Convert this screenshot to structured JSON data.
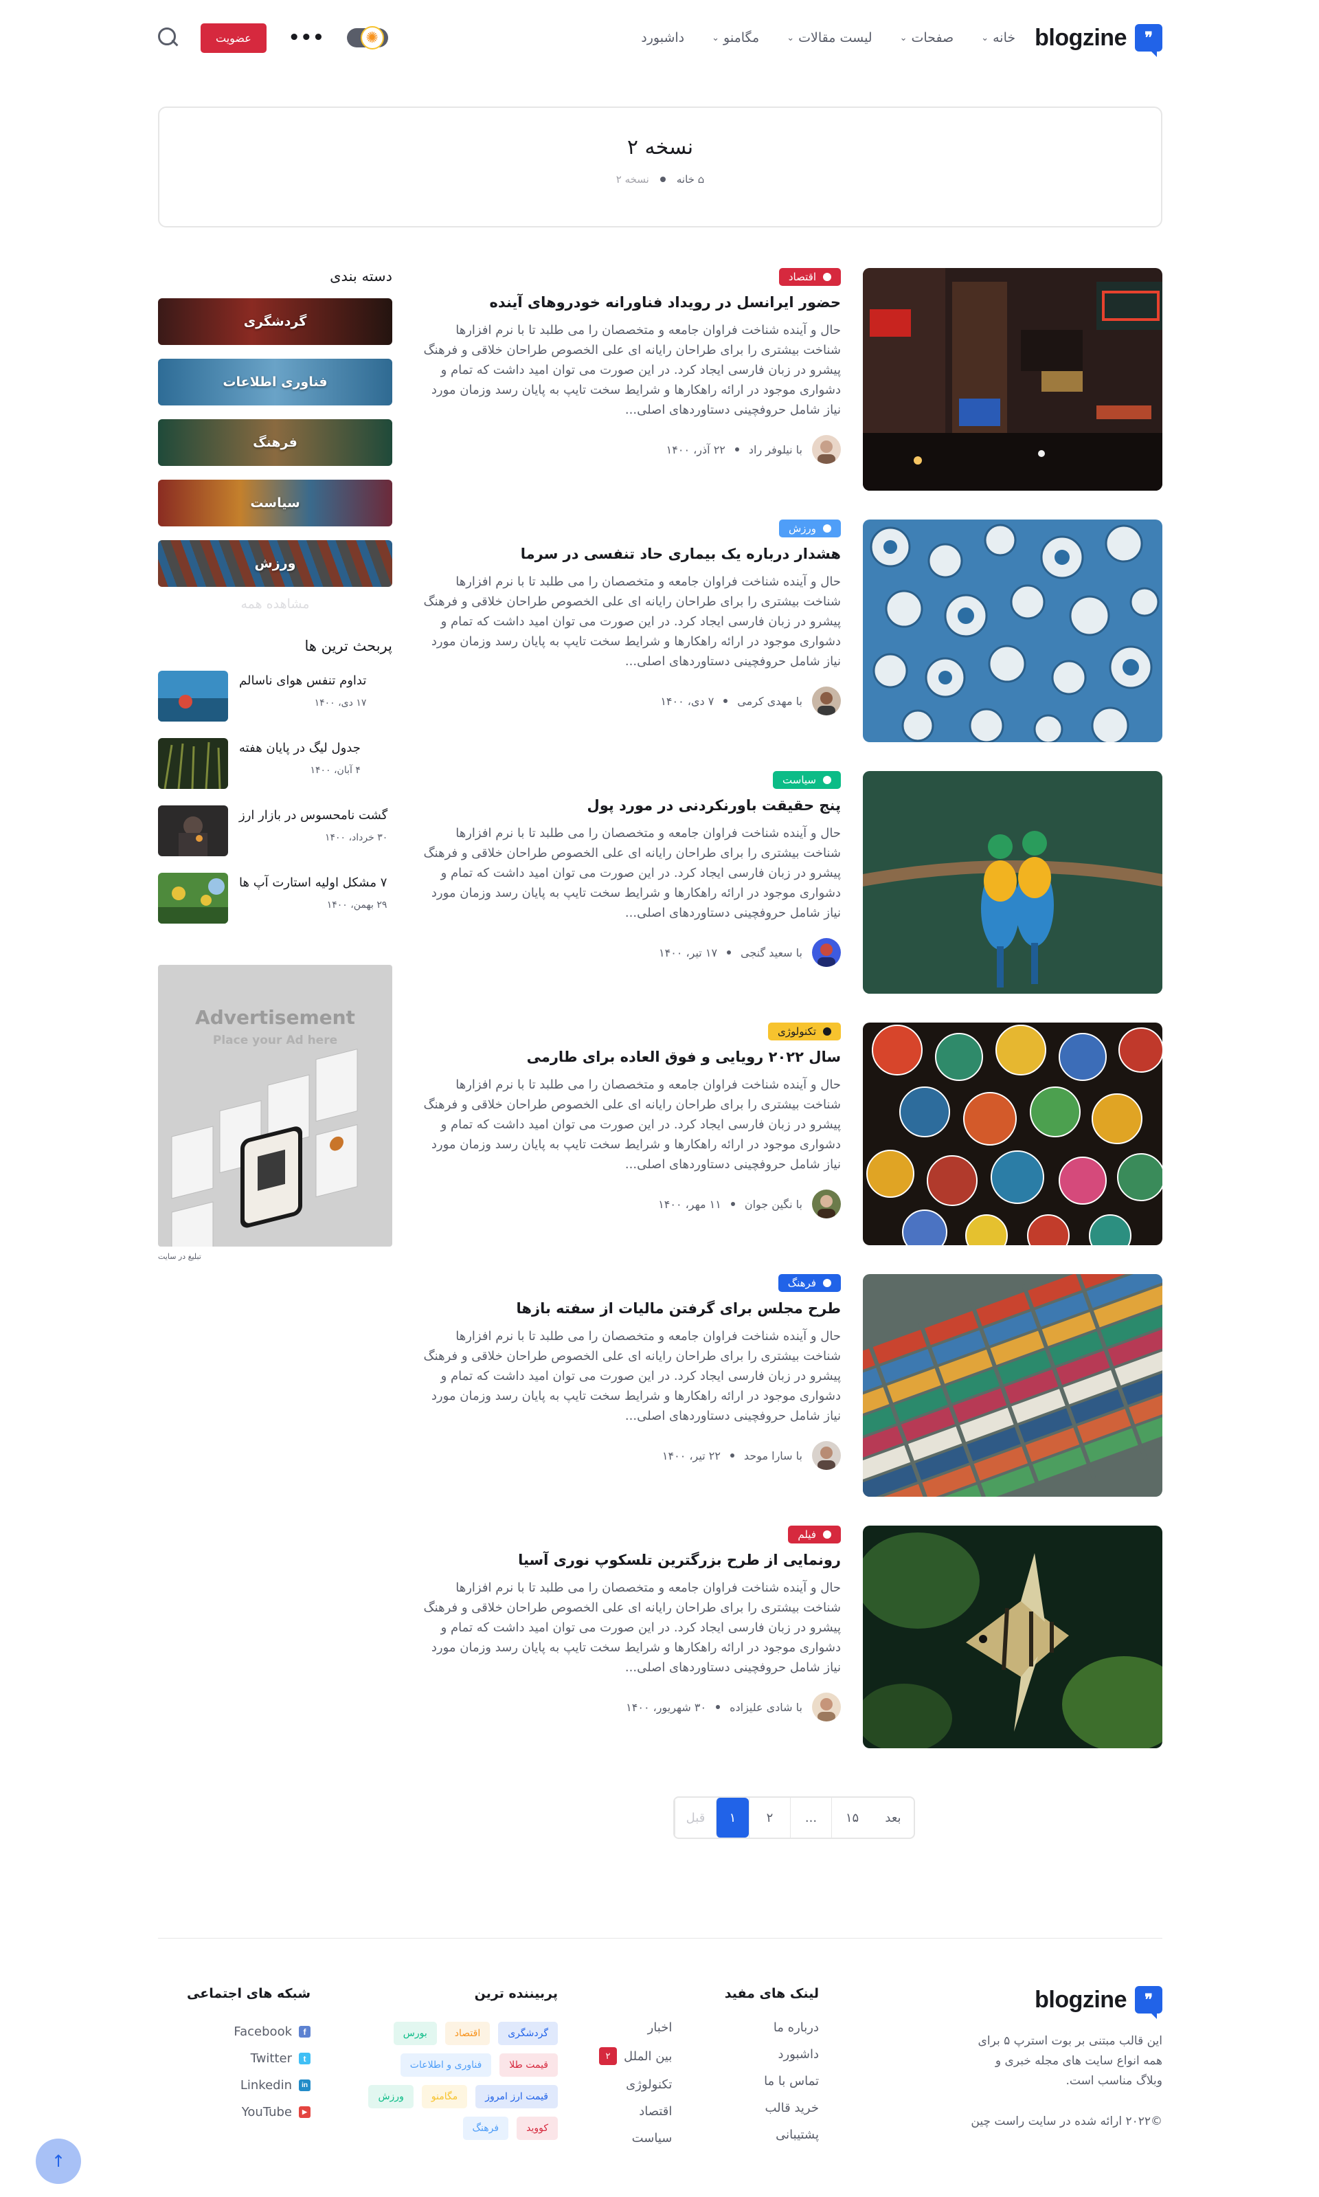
{
  "header": {
    "logo_text": "blogzine",
    "nav": [
      {
        "label": "خانه",
        "has_dropdown": true
      },
      {
        "label": "صفحات",
        "has_dropdown": true
      },
      {
        "label": "لیست مقالات",
        "has_dropdown": true
      },
      {
        "label": "مگامنو",
        "has_dropdown": true
      },
      {
        "label": "داشبورد",
        "has_dropdown": false
      }
    ],
    "join_label": "عضویت",
    "more_label": "•••"
  },
  "page_title": "نسخه ۲",
  "breadcrumb": {
    "home": "خانه",
    "current": "نسخه ۲"
  },
  "posts": [
    {
      "badge": "اقتصاد",
      "badge_color": "#d6293e",
      "title": "حضور ایرانسل در رویداد فناورانه خودروهای آینده",
      "excerpt": "حال و آینده شناخت فراوان جامعه و متخصصان را می طلبد تا با نرم افزارها شناخت بیشتری را برای طراحان رایانه ای علی الخصوص طراحان خلاقی و فرهنگ پیشرو در زبان فارسی ایجاد کرد. در این صورت می توان امید داشت که تمام و دشواری موجود در ارائه راهکارها و شرایط سخت تایپ به پایان رسد وزمان مورد نیاز شامل حروفچینی دستاوردهای اصلی...",
      "author": "با نیلوفر راد",
      "date": "۲۲ آذر، ۱۴۰۰"
    },
    {
      "badge": "ورزش",
      "badge_color": "#4f9ef8",
      "title": "هشدار درباره یک بیماری حاد تنفسی در سرما",
      "excerpt": "حال و آینده شناخت فراوان جامعه و متخصصان را می طلبد تا با نرم افزارها شناخت بیشتری را برای طراحان رایانه ای علی الخصوص طراحان خلاقی و فرهنگ پیشرو در زبان فارسی ایجاد کرد. در این صورت می توان امید داشت که تمام و دشواری موجود در ارائه راهکارها و شرایط سخت تایپ به پایان رسد وزمان مورد نیاز شامل حروفچینی دستاوردهای اصلی...",
      "author": "با مهدی کرمی",
      "date": "۷ دی، ۱۴۰۰"
    },
    {
      "badge": "سیاست",
      "badge_color": "#0cbc87",
      "title": "پنج حقیقت باورنکردنی در مورد پول",
      "excerpt": "حال و آینده شناخت فراوان جامعه و متخصصان را می طلبد تا با نرم افزارها شناخت بیشتری را برای طراحان رایانه ای علی الخصوص طراحان خلاقی و فرهنگ پیشرو در زبان فارسی ایجاد کرد. در این صورت می توان امید داشت که تمام و دشواری موجود در ارائه راهکارها و شرایط سخت تایپ به پایان رسد وزمان مورد نیاز شامل حروفچینی دستاوردهای اصلی...",
      "author": "با سعید گنجی",
      "date": "۱۷ تیر، ۱۴۰۰"
    },
    {
      "badge": "تکنولوژی",
      "badge_color": "#f7c32e",
      "title": "سال ۲۰۲۲ رویایی و فوق العاده برای طارمی",
      "excerpt": "حال و آینده شناخت فراوان جامعه و متخصصان را می طلبد تا با نرم افزارها شناخت بیشتری را برای طراحان رایانه ای علی الخصوص طراحان خلاقی و فرهنگ پیشرو در زبان فارسی ایجاد کرد. در این صورت می توان امید داشت که تمام و دشواری موجود در ارائه راهکارها و شرایط سخت تایپ به پایان رسد وزمان مورد نیاز شامل حروفچینی دستاوردهای اصلی...",
      "author": "با نگین جوان",
      "date": "۱۱ مهر، ۱۴۰۰"
    },
    {
      "badge": "فرهنگ",
      "badge_color": "#2163e8",
      "title": "طرح مجلس برای گرفتن مالیات از سفته بازها",
      "excerpt": "حال و آینده شناخت فراوان جامعه و متخصصان را می طلبد تا با نرم افزارها شناخت بیشتری را برای طراحان رایانه ای علی الخصوص طراحان خلاقی و فرهنگ پیشرو در زبان فارسی ایجاد کرد. در این صورت می توان امید داشت که تمام و دشواری موجود در ارائه راهکارها و شرایط سخت تایپ به پایان رسد وزمان مورد نیاز شامل حروفچینی دستاوردهای اصلی...",
      "author": "با سارا موحد",
      "date": "۲۲ تیر، ۱۴۰۰"
    },
    {
      "badge": "فیلم",
      "badge_color": "#d6293e",
      "title": "رونمایی از طرح بزرگترین تلسکوپ نوری آسیا",
      "excerpt": "حال و آینده شناخت فراوان جامعه و متخصصان را می طلبد تا با نرم افزارها شناخت بیشتری را برای طراحان رایانه ای علی الخصوص طراحان خلاقی و فرهنگ پیشرو در زبان فارسی ایجاد کرد. در این صورت می توان امید داشت که تمام و دشواری موجود در ارائه راهکارها و شرایط سخت تایپ به پایان رسد وزمان مورد نیاز شامل حروفچینی دستاوردهای اصلی...",
      "author": "با شادی علیزاده",
      "date": "۳۰ شهریور، ۱۴۰۰"
    }
  ],
  "sidebar": {
    "categories_title": "دسته بندی",
    "categories": [
      "گردشگری",
      "فناوری اطلاعات",
      "فرهنگ",
      "سیاست",
      "ورزش"
    ],
    "view_all": "مشاهده همه",
    "trending_title": "پربحث ترین ها",
    "trending": [
      {
        "title": "تداوم تنفس هوای ناسالم",
        "date": "۱۷ دی، ۱۴۰۰"
      },
      {
        "title": "جدول لیگ در پایان هفته",
        "date": "۴ آبان، ۱۴۰۰"
      },
      {
        "title": "گشت نامحسوس در بازار ارز",
        "date": "۳۰ خرداد، ۱۴۰۰"
      },
      {
        "title": "۷ مشکل اولیه استارت آپ ها",
        "date": "۲۹ بهمن، ۱۴۰۰"
      }
    ],
    "ad_title": "Advertisement",
    "ad_sub": "Place your Ad here",
    "ad_caption": "تبلیغ در سایت"
  },
  "pagination": {
    "prev": "قبل",
    "pages": [
      "۱",
      "۲",
      "...",
      "۱۵"
    ],
    "next": "بعد",
    "active": "۱"
  },
  "footer": {
    "logo_text": "blogzine",
    "about": "این قالب مبتنی بر بوت استرپ ۵ برای همه انواع سایت های مجله خبری و وبلاگ مناسب است.",
    "copyright": "©۲۰۲۲ ارائه شده در سایت راست چین",
    "links_title": "لینک های مفید",
    "links_col1": [
      "درباره ما",
      "داشبورد",
      "تماس با ما",
      "خرید قالب",
      "پشتیبانی"
    ],
    "links_col2": [
      "اخبار",
      "بین الملل",
      "تکنولوژی",
      "اقتصاد",
      "سیاست"
    ],
    "links_badge": "۲",
    "tags_title": "پربیننده ترین",
    "tags": [
      {
        "label": "گردشگری",
        "color": "#2163e8",
        "bg": "#e0e9fc"
      },
      {
        "label": "اقتصاد",
        "color": "#f7931e",
        "bg": "#fdf3e3"
      },
      {
        "label": "بورس",
        "color": "#0cbc87",
        "bg": "#e2f7f0"
      },
      {
        "label": "قیمت طلا",
        "color": "#d6293e",
        "bg": "#fbe5e8"
      },
      {
        "label": "فناوری و اطلاعات",
        "color": "#4f9ef8",
        "bg": "#e8f2fe"
      },
      {
        "label": "قیمت ارز امروز",
        "color": "#2163e8",
        "bg": "#e0e9fc"
      },
      {
        "label": "مگامنو",
        "color": "#f7c32e",
        "bg": "#fef6e1"
      },
      {
        "label": "ورزش",
        "color": "#0cbc87",
        "bg": "#e2f7f0"
      },
      {
        "label": "کووید",
        "color": "#d6293e",
        "bg": "#fbe5e8"
      },
      {
        "label": "فرهنگ",
        "color": "#4f9ef8",
        "bg": "#e8f2fe"
      }
    ],
    "social_title": "شبکه های اجتماعی",
    "social": [
      {
        "label": "Facebook",
        "color": "#5d82d1",
        "glyph": "f"
      },
      {
        "label": "Twitter",
        "color": "#40bff5",
        "glyph": "t"
      },
      {
        "label": "Linkedin",
        "color": "#238cc8",
        "glyph": "in"
      },
      {
        "label": "YouTube",
        "color": "#e44540",
        "glyph": "▶"
      }
    ]
  },
  "back_to_top": "↑"
}
